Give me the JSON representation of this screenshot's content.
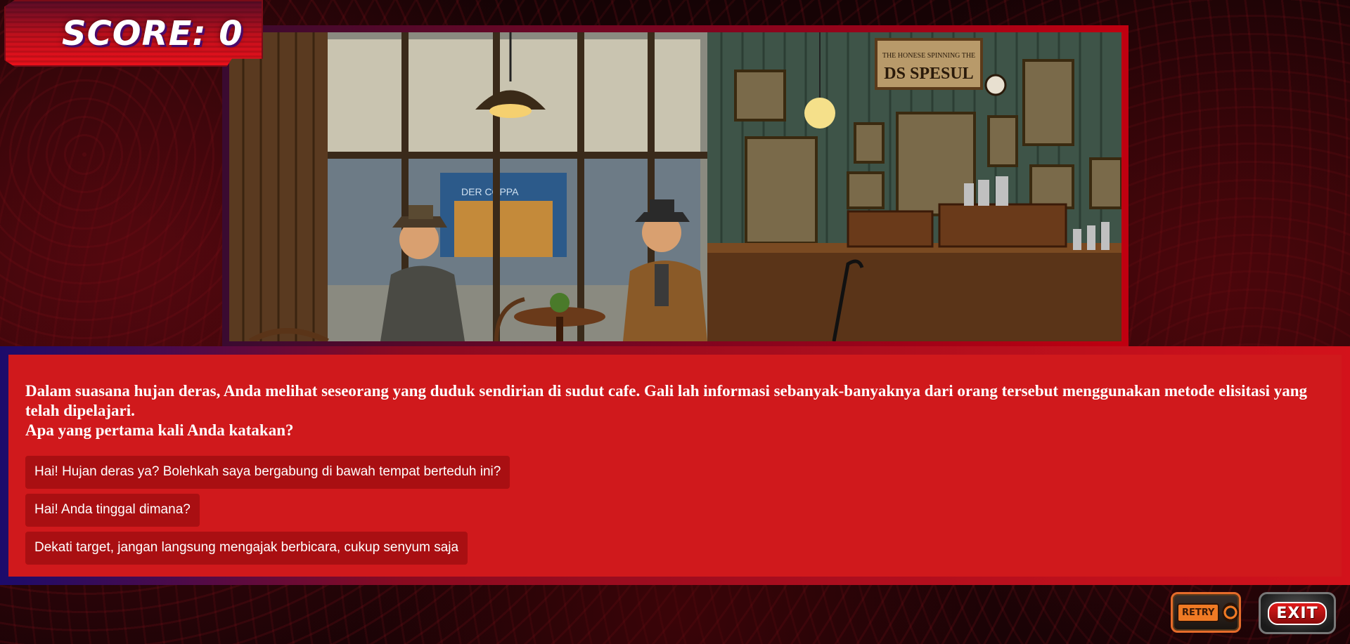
{
  "score": {
    "text": "SCORE: 0",
    "value": 0
  },
  "scene": {
    "sign_line1": "THE HONESE SPINNING THE",
    "sign_line2": "DS SPESUL",
    "shop_sign": "DER COPPA"
  },
  "dialog": {
    "question_line1": "Dalam suasana hujan deras, Anda melihat seseorang yang duduk sendirian di sudut cafe. Gali lah informasi sebanyak-banyaknya dari orang tersebut menggunakan metode elisitasi yang telah dipelajari.",
    "question_line2": "Apa yang pertama kali Anda katakan?",
    "choices": [
      {
        "label": "Hai! Hujan deras ya? Bolehkah saya bergabung di bawah tempat berteduh ini?"
      },
      {
        "label": "Hai! Anda tinggal dimana?"
      },
      {
        "label": "Dekati target, jangan langsung mengajak berbicara, cukup senyum saja"
      }
    ]
  },
  "controls": {
    "retry_label": "RETRY",
    "exit_label": "EXIT"
  },
  "colors": {
    "dialog_bg": "#d0191c",
    "choice_bg": "#a90f12",
    "frame_accent": "#c00010"
  }
}
